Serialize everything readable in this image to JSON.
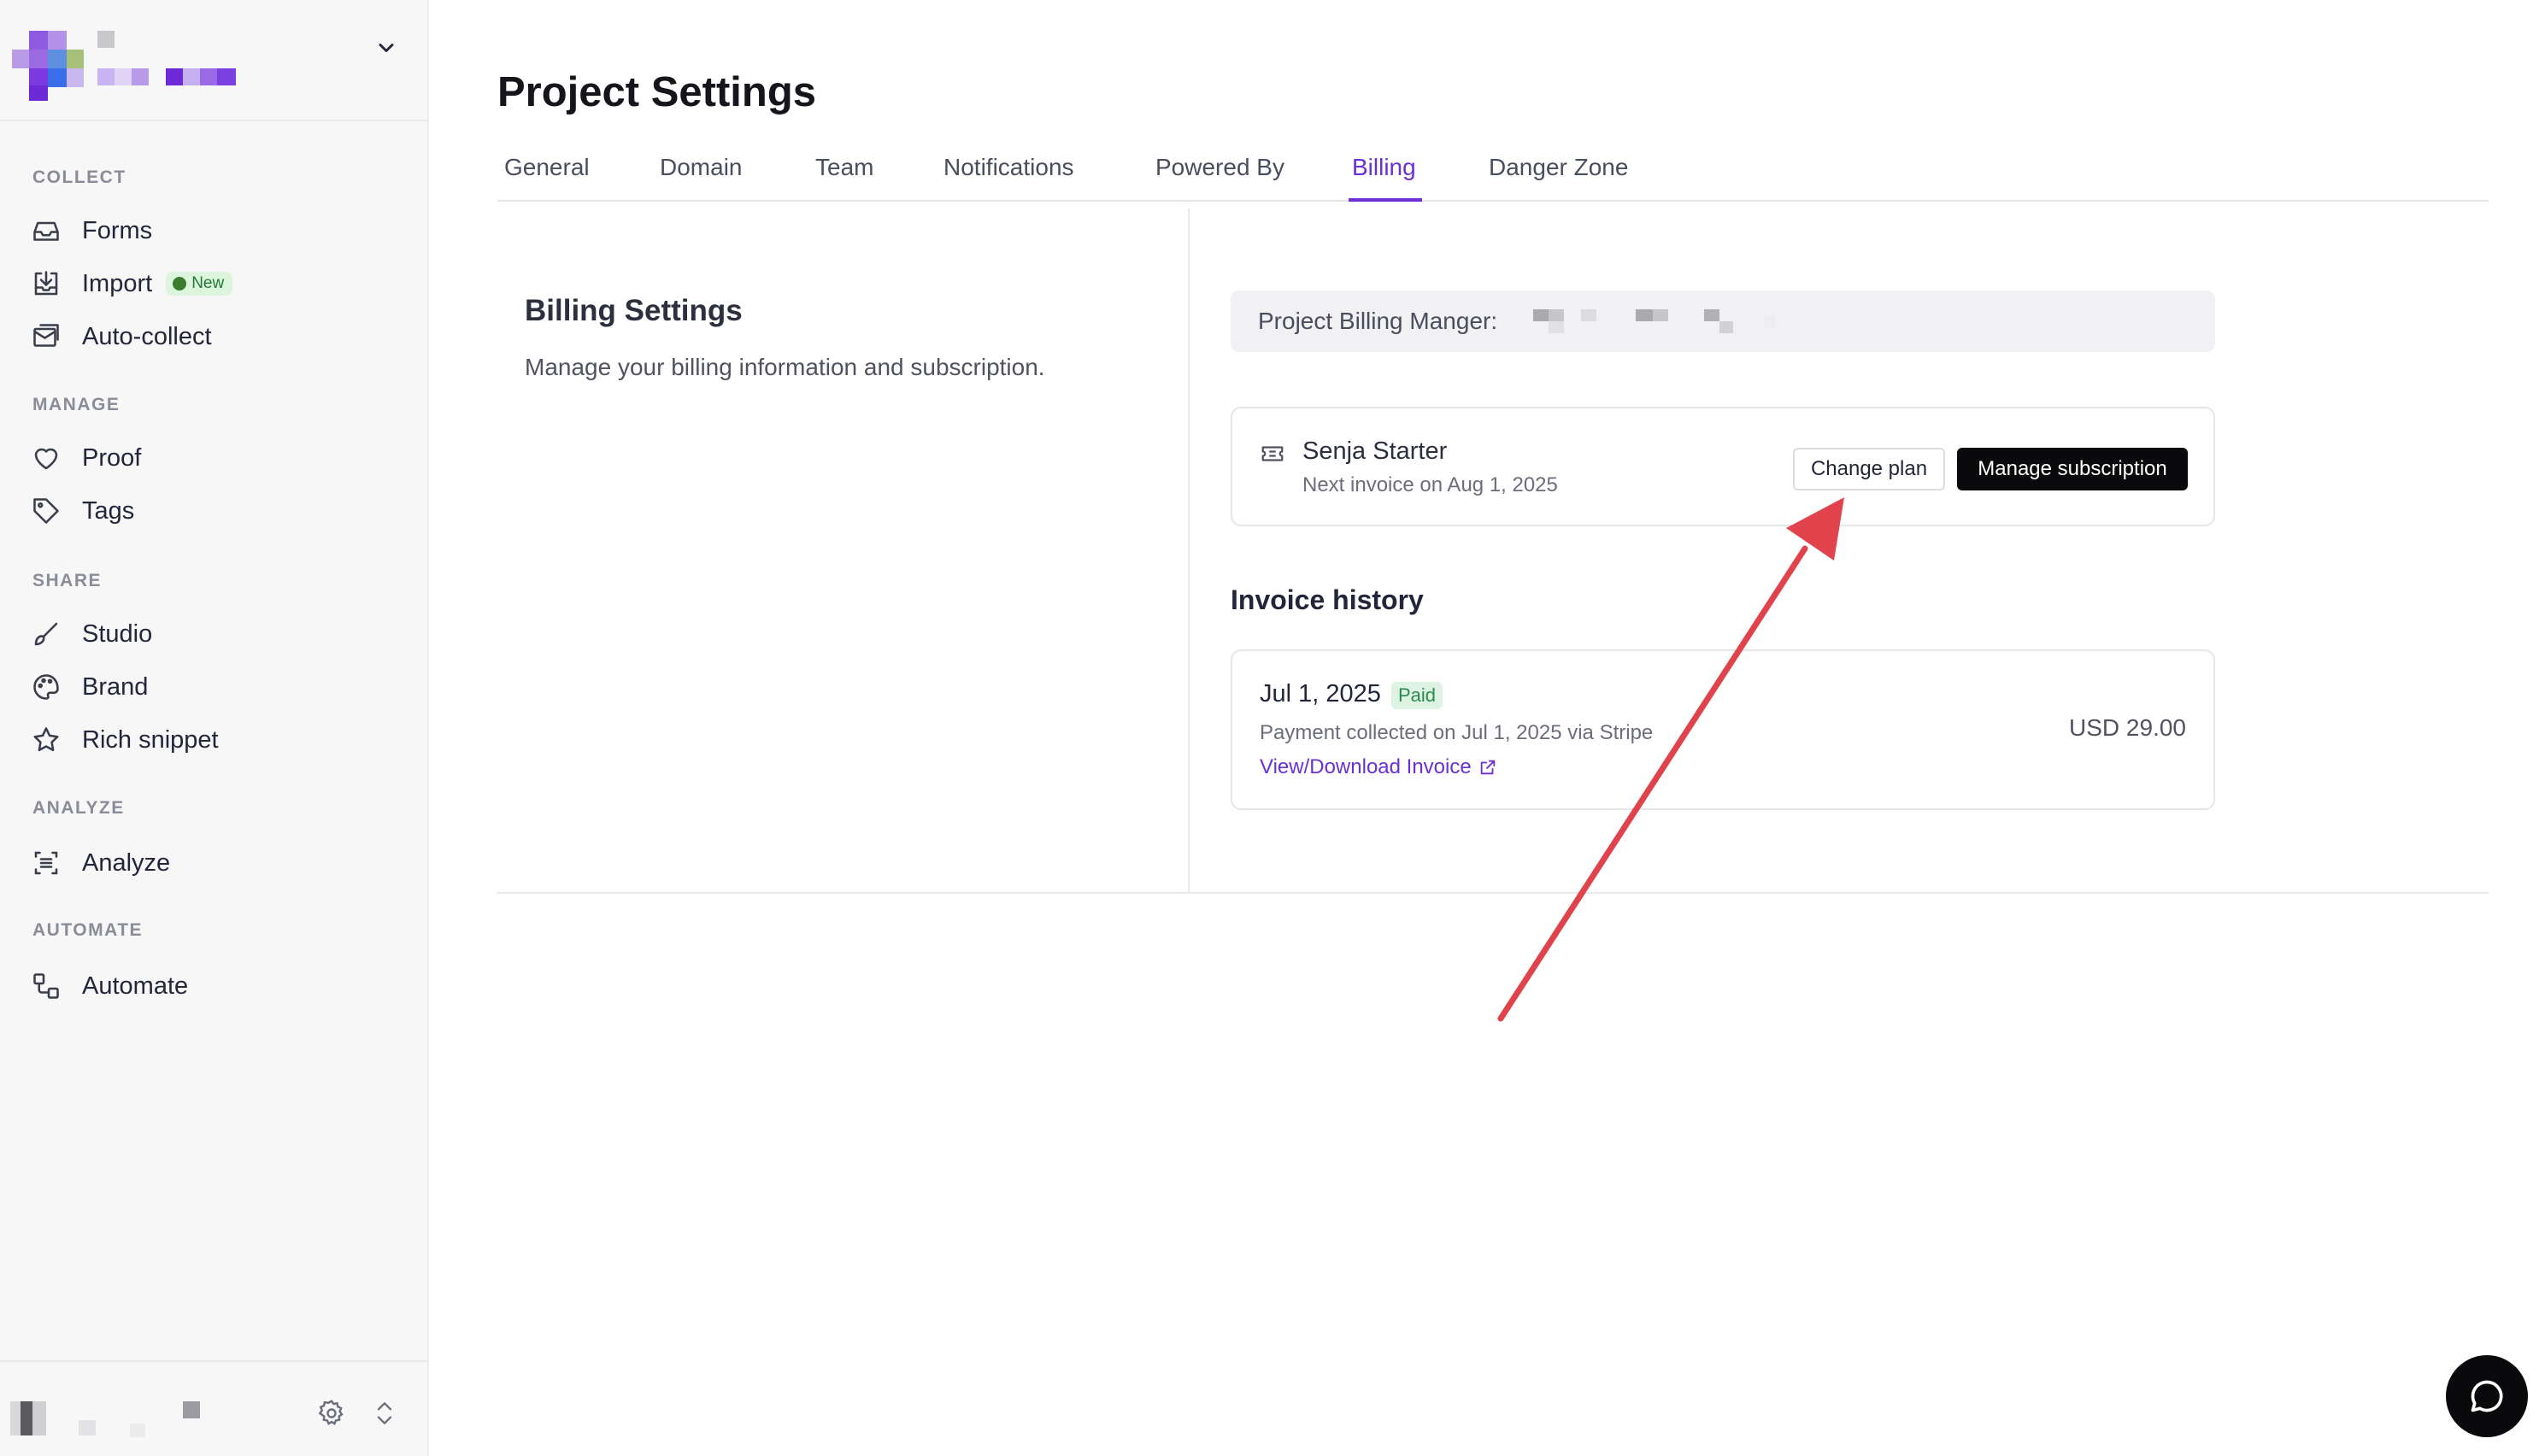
{
  "sidebar": {
    "sections": {
      "collect": "COLLECT",
      "manage": "MANAGE",
      "share": "SHARE",
      "analyze": "ANALYZE",
      "automate": "AUTOMATE"
    },
    "items": {
      "forms": "Forms",
      "import": "Import",
      "import_badge": "New",
      "autocollect": "Auto-collect",
      "proof": "Proof",
      "tags": "Tags",
      "studio": "Studio",
      "brand": "Brand",
      "rich_snippet": "Rich snippet",
      "analyze": "Analyze",
      "automate": "Automate"
    }
  },
  "page": {
    "title": "Project Settings",
    "tabs": [
      "General",
      "Domain",
      "Team",
      "Notifications",
      "Powered By",
      "Billing",
      "Danger Zone"
    ],
    "active_tab": "Billing"
  },
  "billing": {
    "title": "Billing Settings",
    "description": "Manage your billing information and subscription.",
    "manager_label": "Project Billing Manger:",
    "plan": {
      "name": "Senja Starter",
      "next_invoice": "Next invoice on Aug 1, 2025",
      "change_label": "Change plan",
      "manage_label": "Manage subscription"
    },
    "invoice_history": {
      "title": "Invoice history",
      "items": [
        {
          "date": "Jul 1, 2025",
          "status": "Paid",
          "note": "Payment collected on Jul 1, 2025 via Stripe",
          "link": "View/Download Invoice",
          "amount": "USD 29.00"
        }
      ]
    }
  },
  "colors": {
    "accent": "#6b2fd6",
    "annotation_arrow": "#e0434b",
    "paid_badge_bg": "#def3e4"
  }
}
